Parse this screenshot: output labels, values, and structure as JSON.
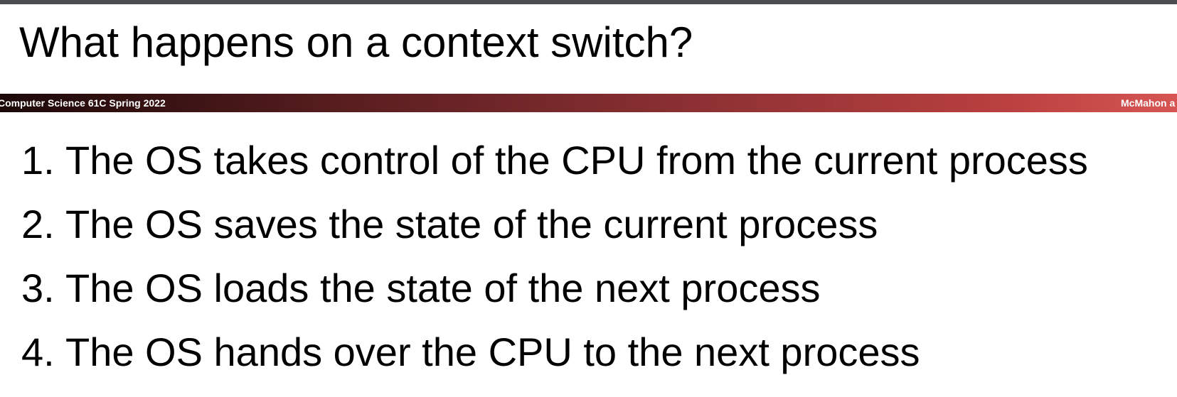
{
  "slide": {
    "title": "What happens on a context switch?"
  },
  "banner": {
    "left_text": "Computer Science 61C Spring 2022",
    "right_text": "McMahon a"
  },
  "steps": [
    {
      "number": "1.",
      "text": "The OS takes control of the CPU from the current process"
    },
    {
      "number": "2.",
      "text": "The OS saves the state of the current process"
    },
    {
      "number": "3.",
      "text": "The OS loads the state of the next process"
    },
    {
      "number": "4.",
      "text": "The OS hands over the CPU to the next process"
    }
  ],
  "colors": {
    "top_rule": "#4a4d50",
    "banner_start": "#1c0808",
    "banner_end": "#d65553",
    "text": "#000000"
  }
}
